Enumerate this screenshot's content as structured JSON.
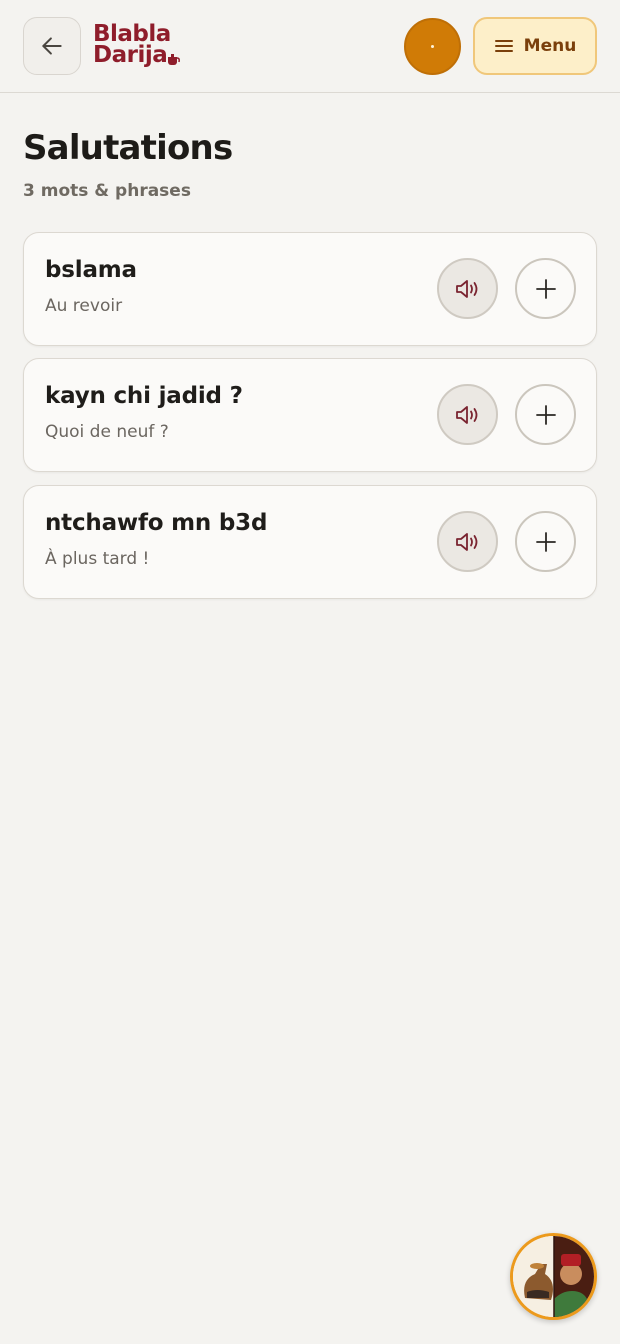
{
  "header": {
    "logo_line1": "Blabla",
    "logo_line2": "Darija",
    "menu_label": "Menu"
  },
  "page": {
    "title": "Salutations",
    "subtitle": "3 mots & phrases"
  },
  "cards": [
    {
      "term": "bslama",
      "translation": "Au revoir"
    },
    {
      "term": "kayn chi jadid ?",
      "translation": "Quoi de neuf ?"
    },
    {
      "term": "ntchawfo mn b3d",
      "translation": "À plus tard !"
    }
  ],
  "icons": {
    "back": "arrow-left-icon",
    "menu": "hamburger-icon",
    "audio": "speaker-icon",
    "add": "plus-icon"
  },
  "colors": {
    "brand": "#8f1d2b",
    "accent": "#d07b06",
    "menu_bg": "#fdefc9",
    "background": "#f4f3f0"
  }
}
